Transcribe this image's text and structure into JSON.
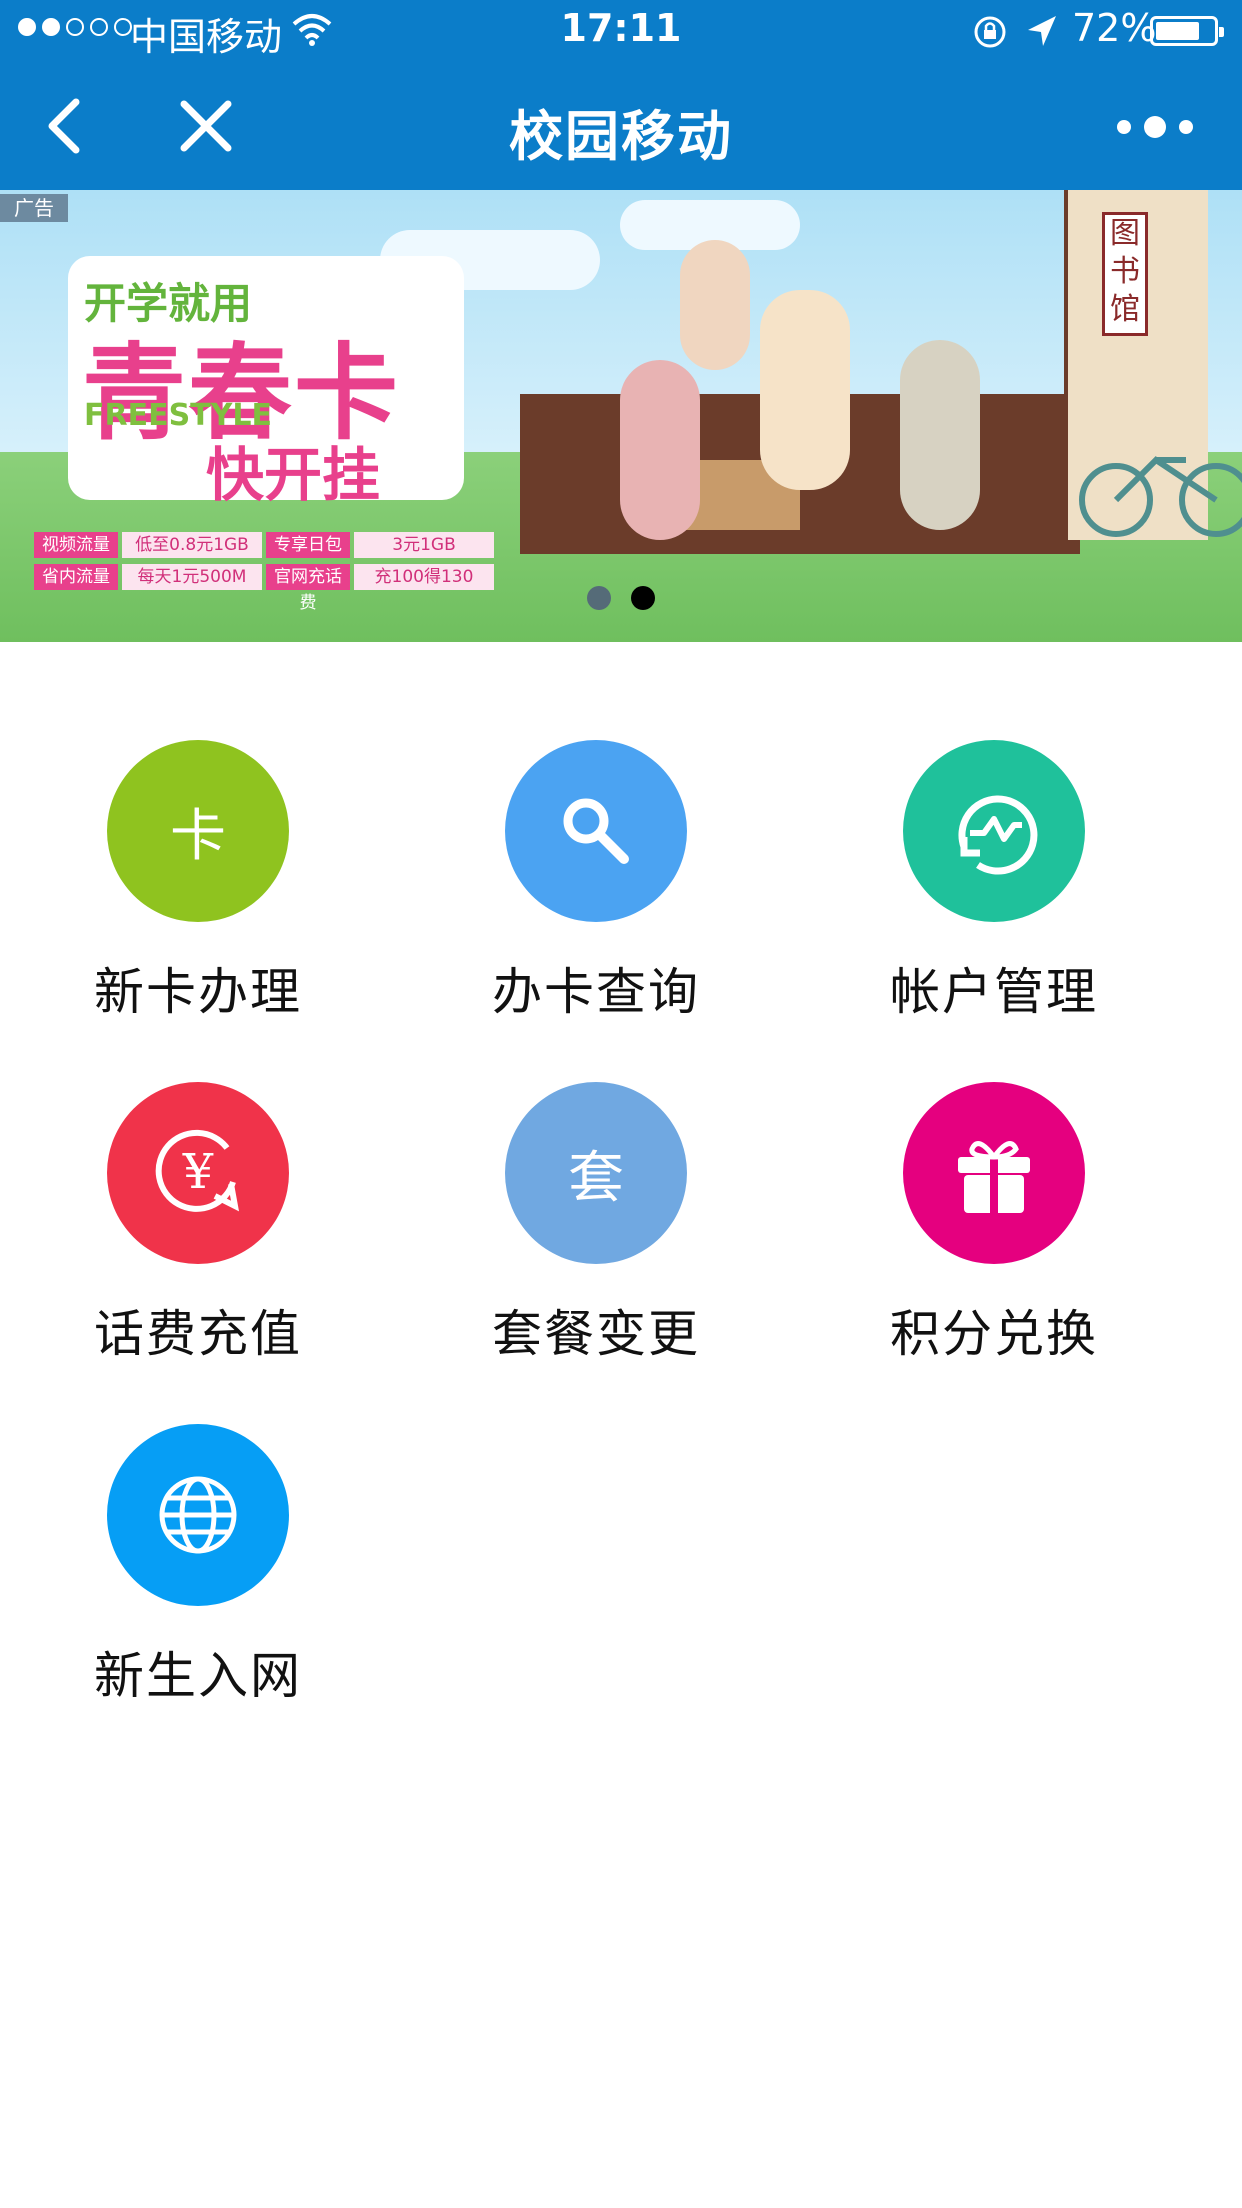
{
  "status_bar": {
    "carrier": "中国移动",
    "time": "17:11",
    "battery": "72%"
  },
  "nav": {
    "title": "校园移动"
  },
  "banner": {
    "ad_label": "广告",
    "line1": "开学就用",
    "line2": "青春卡",
    "line3": "FREESTYLE",
    "line4": "快开挂",
    "prices": [
      {
        "label": "视频流量",
        "value": "低至0.8元1GB"
      },
      {
        "label": "专享日包",
        "value": "3元1GB"
      },
      {
        "label": "省内流量",
        "value": "每天1元500M"
      },
      {
        "label": "官网充话费",
        "value": "充100得130"
      }
    ],
    "library_sign": "图书馆",
    "page_count": 2,
    "active_page": 2
  },
  "menu": [
    {
      "id": "new-card",
      "label": "新卡办理",
      "glyph": "卡",
      "color": "#8fc31f",
      "icon": "card-icon"
    },
    {
      "id": "card-query",
      "label": "办卡查询",
      "glyph": "",
      "color": "#4ba3f2",
      "icon": "search-icon"
    },
    {
      "id": "account",
      "label": "帐户管理",
      "glyph": "",
      "color": "#1fc19b",
      "icon": "activity-icon"
    },
    {
      "id": "recharge",
      "label": "话费充值",
      "glyph": "¥",
      "color": "#f0334a",
      "icon": "recharge-icon"
    },
    {
      "id": "plan-change",
      "label": "套餐变更",
      "glyph": "套",
      "color": "#70a8e1",
      "icon": "plan-icon"
    },
    {
      "id": "points",
      "label": "积分兑换",
      "glyph": "",
      "color": "#e5007f",
      "icon": "gift-icon"
    },
    {
      "id": "freshman",
      "label": "新生入网",
      "glyph": "",
      "color": "#069ef5",
      "icon": "globe-icon"
    }
  ]
}
